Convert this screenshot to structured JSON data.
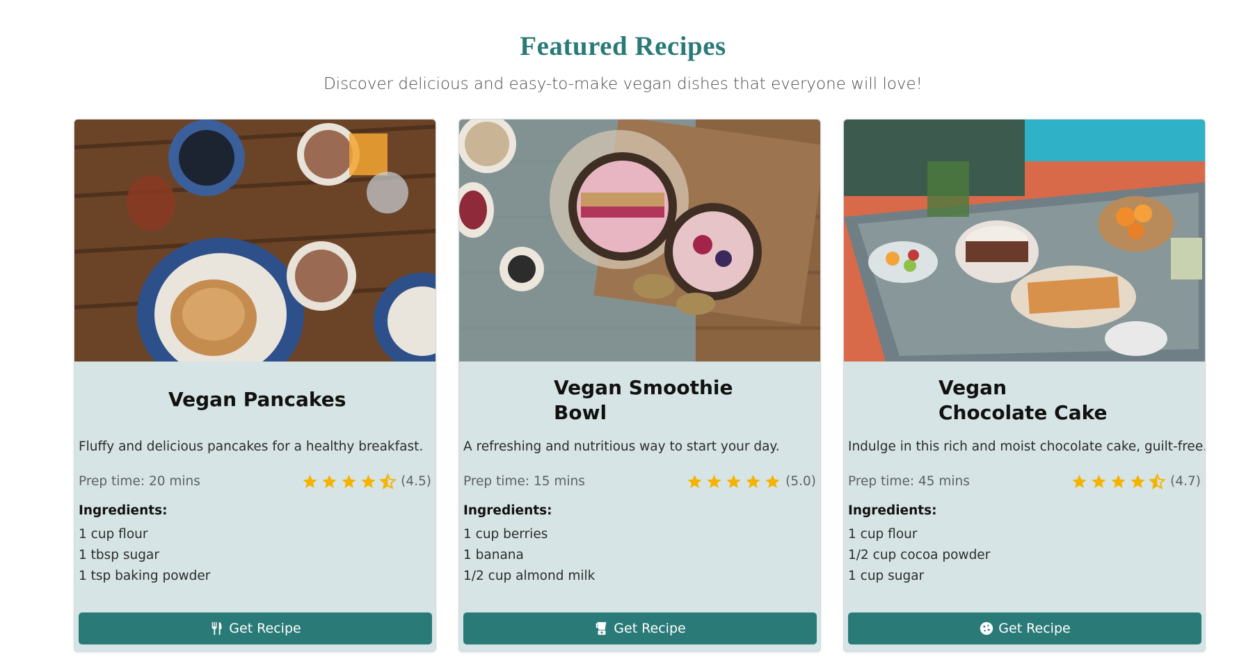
{
  "header": {
    "title": "Featured Recipes",
    "subtitle": "Discover delicious and easy-to-make vegan dishes that everyone will love!"
  },
  "colors": {
    "accent": "#2a7a78",
    "card_bg": "#d6e4e5",
    "star": "#f5b301"
  },
  "recipes": [
    {
      "title": "Vegan Pancakes",
      "image": "pancakes-breakfast-table-photo",
      "description": "Fluffy and delicious pancakes for a healthy breakfast.",
      "prep_time": "Prep time: 20 mins",
      "rating": 4.5,
      "rating_text": "(4.5)",
      "ingredients_label": "Ingredients:",
      "ingredients": [
        "1 cup flour",
        "1 tbsp sugar",
        "1 tsp baking powder"
      ],
      "button_label": "Get Recipe",
      "button_icon": "utensils-icon"
    },
    {
      "title": "Vegan Smoothie Bowl",
      "image": "smoothie-bowls-photo",
      "description": "A refreshing and nutritious way to start your day.",
      "prep_time": "Prep time: 15 mins",
      "rating": 5.0,
      "rating_text": "(5.0)",
      "ingredients_label": "Ingredients:",
      "ingredients": [
        "1 cup berries",
        "1 banana",
        "1/2 cup almond milk"
      ],
      "button_label": "Get Recipe",
      "button_icon": "blender-icon"
    },
    {
      "title": "Vegan Chocolate Cake",
      "image": "dessert-buffet-photo",
      "description": "Indulge in this rich and moist chocolate cake, guilt-free.",
      "prep_time": "Prep time: 45 mins",
      "rating": 4.7,
      "rating_text": "(4.7)",
      "ingredients_label": "Ingredients:",
      "ingredients": [
        "1 cup flour",
        "1/2 cup cocoa powder",
        "1 cup sugar"
      ],
      "button_label": "Get Recipe",
      "button_icon": "cookie-icon"
    }
  ]
}
